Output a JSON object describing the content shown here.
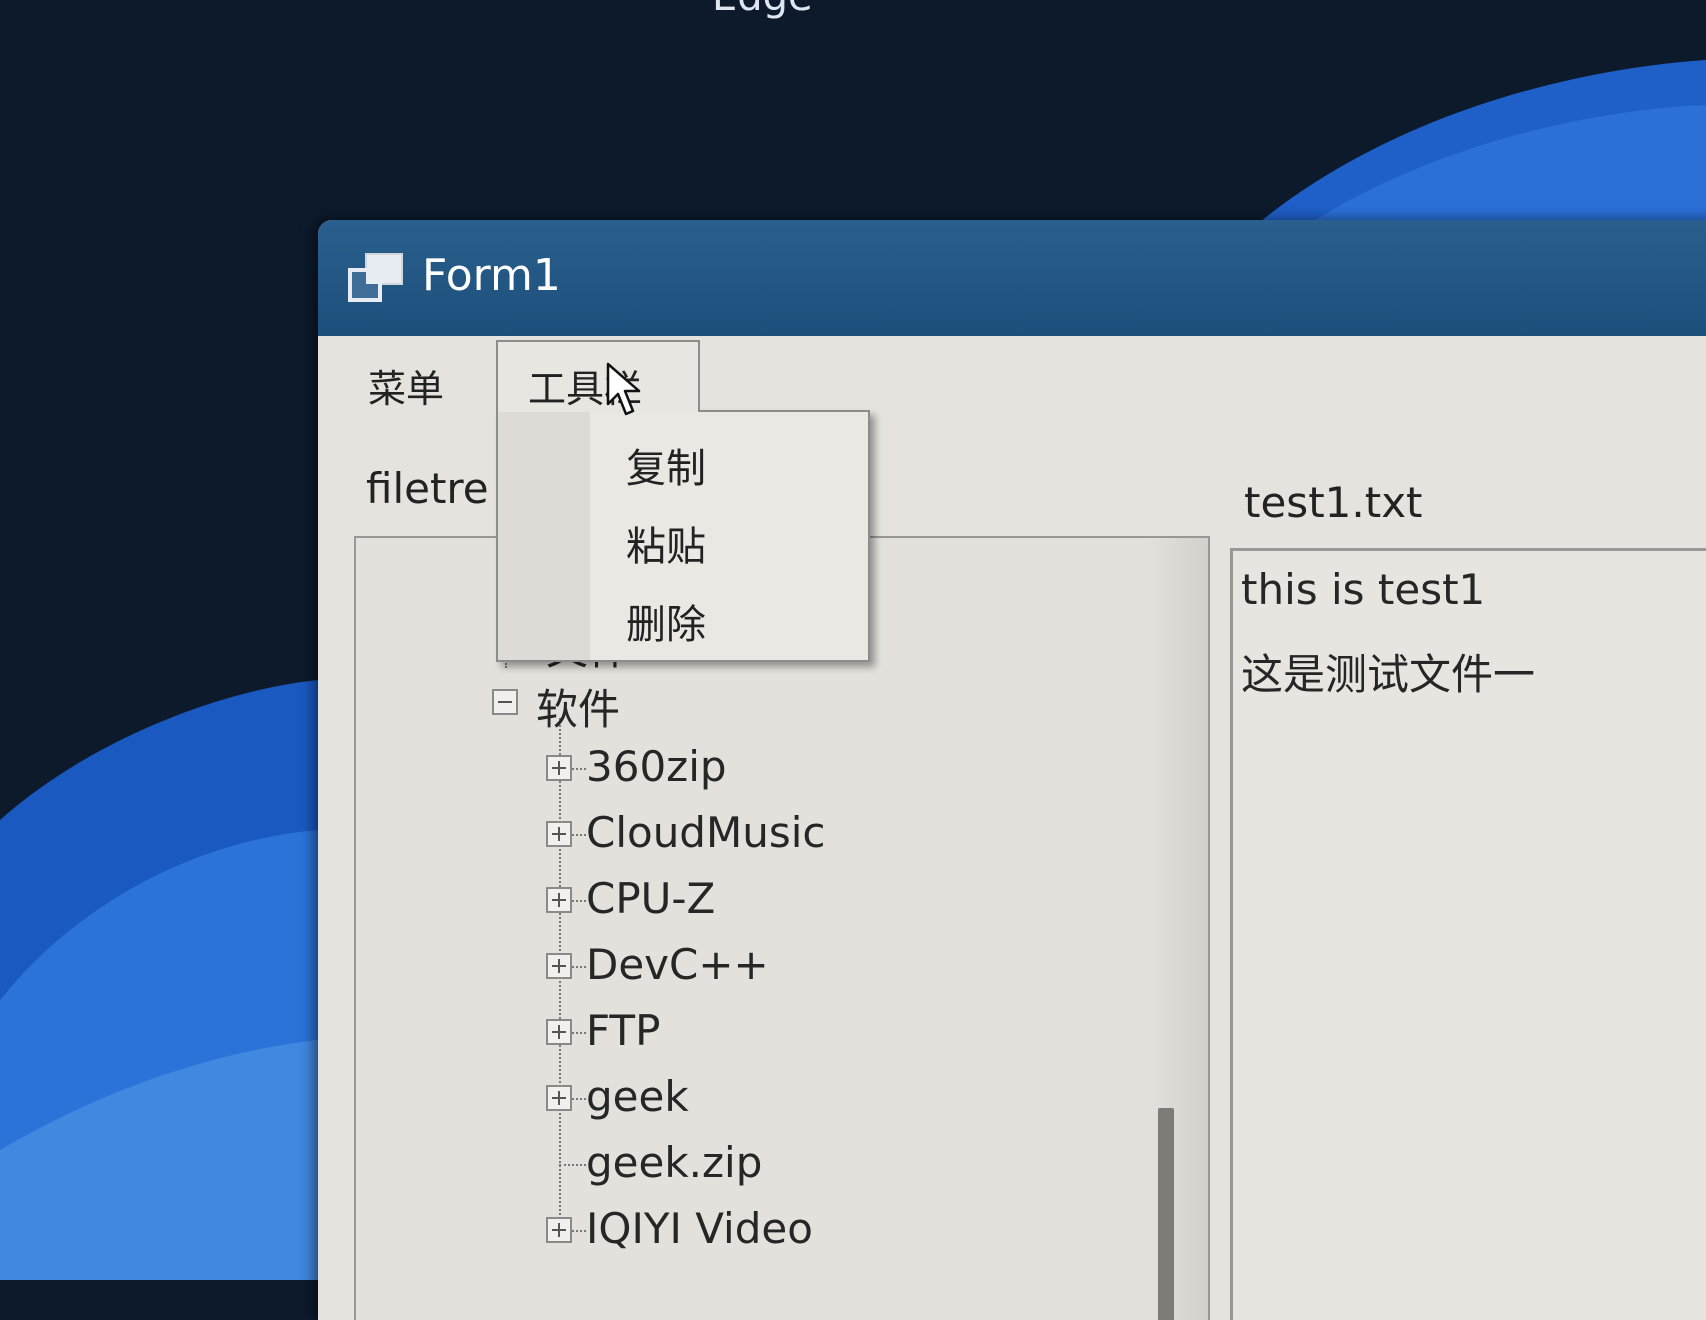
{
  "desktop": {
    "partial_app_label": "Edge"
  },
  "window": {
    "title": "Form1"
  },
  "menubar": {
    "items": [
      "菜单",
      "工具栏"
    ]
  },
  "dropdown": {
    "items": [
      "复制",
      "粘贴",
      "删除"
    ]
  },
  "left_panel": {
    "label": "filetre"
  },
  "right_panel": {
    "label": "test1.txt",
    "lines": [
      "this is test1",
      "这是测试文件一"
    ]
  },
  "tree": {
    "partial_node": "文件",
    "parent": {
      "label": "软件",
      "expanded": true
    },
    "children": [
      {
        "label": "360zip",
        "expandable": true
      },
      {
        "label": "CloudMusic",
        "expandable": true
      },
      {
        "label": "CPU-Z",
        "expandable": true
      },
      {
        "label": "DevC++",
        "expandable": true
      },
      {
        "label": "FTP",
        "expandable": true
      },
      {
        "label": "geek",
        "expandable": true
      },
      {
        "label": "geek.zip",
        "expandable": false
      },
      {
        "label": "IQIYI Video",
        "expandable": true
      }
    ]
  }
}
